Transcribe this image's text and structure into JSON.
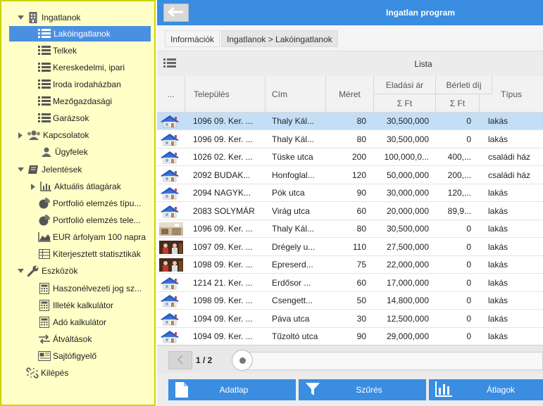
{
  "sidebar": {
    "items": [
      {
        "label": "Ingatlanok"
      },
      {
        "label": "Lakóingatlanok"
      },
      {
        "label": "Telkek"
      },
      {
        "label": "Kereskedelmi, ipari"
      },
      {
        "label": "Iroda irodaházban"
      },
      {
        "label": "Mezőgazdasági"
      },
      {
        "label": "Garázsok"
      },
      {
        "label": "Kapcsolatok"
      },
      {
        "label": "Ügyfelek"
      },
      {
        "label": "Jelentések"
      },
      {
        "label": "Aktuális átlagárak"
      },
      {
        "label": "Portfolió elemzés típu..."
      },
      {
        "label": "Portfolió elemzés tele..."
      },
      {
        "label": "EUR árfolyam 100 napra"
      },
      {
        "label": "Kiterjesztett statisztikák"
      },
      {
        "label": "Eszközök"
      },
      {
        "label": "Haszonélvezeti jog sz..."
      },
      {
        "label": "Illeték kalkulátor"
      },
      {
        "label": "Adó kalkulátor"
      },
      {
        "label": "Átváltások"
      },
      {
        "label": "Sajtófigyelő"
      },
      {
        "label": "Kilépés"
      }
    ]
  },
  "header": {
    "title": "Ingatlan program"
  },
  "breadcrumb": {
    "info": "Információk",
    "path": "Ingatlanok > Lakóingatlanok"
  },
  "list": {
    "title": "Lista"
  },
  "table": {
    "columns": {
      "more": "...",
      "telepules": "Település",
      "cim": "Cím",
      "meret": "Méret",
      "eladasi": "Eladási ár",
      "eladasi_sum": "Σ Ft",
      "berleti": "Bérleti díj",
      "berleti_sum": "Σ Ft",
      "tipus": "Típus"
    },
    "rows": [
      {
        "thumb": "house",
        "telepules": "1096 09. Ker. ...",
        "cim": "Thaly Kál...",
        "meret": "80",
        "eladasi": "30,500,000",
        "berleti": "0",
        "tipus": "lakás"
      },
      {
        "thumb": "house",
        "telepules": "1096 09. Ker. ...",
        "cim": "Thaly Kál...",
        "meret": "80",
        "eladasi": "30,500,000",
        "berleti": "0",
        "tipus": "lakás"
      },
      {
        "thumb": "house",
        "telepules": "1026 02. Ker. ...",
        "cim": "Tüske utca",
        "meret": "200",
        "eladasi": "100,000,0...",
        "berleti": "400,...",
        "tipus": "családi ház"
      },
      {
        "thumb": "house",
        "telepules": "2092 BUDAK...",
        "cim": "Honfoglal...",
        "meret": "120",
        "eladasi": "50,000,000",
        "berleti": "200,...",
        "tipus": "családi ház"
      },
      {
        "thumb": "house",
        "telepules": "2094 NAGYK...",
        "cim": "Pók utca",
        "meret": "90",
        "eladasi": "30,000,000",
        "berleti": "120,...",
        "tipus": "lakás"
      },
      {
        "thumb": "house",
        "telepules": "2083 SOLYMÁR",
        "cim": "Virág utca",
        "meret": "60",
        "eladasi": "20,000,000",
        "berleti": "89,9...",
        "tipus": "lakás"
      },
      {
        "thumb": "photo-room",
        "telepules": "1096 09. Ker. ...",
        "cim": "Thaly Kál...",
        "meret": "80",
        "eladasi": "30,500,000",
        "berleti": "0",
        "tipus": "lakás"
      },
      {
        "thumb": "photo-people",
        "telepules": "1097 09. Ker. ...",
        "cim": "Drégely u...",
        "meret": "110",
        "eladasi": "27,500,000",
        "berleti": "0",
        "tipus": "lakás"
      },
      {
        "thumb": "photo-people",
        "telepules": "1098 09. Ker. ...",
        "cim": "Epreserd...",
        "meret": "75",
        "eladasi": "22,000,000",
        "berleti": "0",
        "tipus": "lakás"
      },
      {
        "thumb": "house",
        "telepules": "1214 21. Ker. ...",
        "cim": "Erdősor ...",
        "meret": "60",
        "eladasi": "17,000,000",
        "berleti": "0",
        "tipus": "lakás"
      },
      {
        "thumb": "house",
        "telepules": "1098 09. Ker. ...",
        "cim": "Csengett...",
        "meret": "50",
        "eladasi": "14,800,000",
        "berleti": "0",
        "tipus": "lakás"
      },
      {
        "thumb": "house",
        "telepules": "1094 09. Ker. ...",
        "cim": "Páva utca",
        "meret": "30",
        "eladasi": "12,500,000",
        "berleti": "0",
        "tipus": "lakás"
      },
      {
        "thumb": "house",
        "telepules": "1094 09. Ker. ...",
        "cim": "Tűzoltó utca",
        "meret": "90",
        "eladasi": "29,000,000",
        "berleti": "0",
        "tipus": "lakás"
      }
    ]
  },
  "pager": {
    "page": "1 / 2"
  },
  "toolbar": {
    "adatlap": "Adatlap",
    "szures": "Szűrés",
    "atlagok": "Átlagok"
  },
  "colors": {
    "accent": "#3a8de0",
    "selected": "#4a90e2",
    "row_selected": "#c4def6",
    "sidebar_bg": "#ffffc7"
  }
}
